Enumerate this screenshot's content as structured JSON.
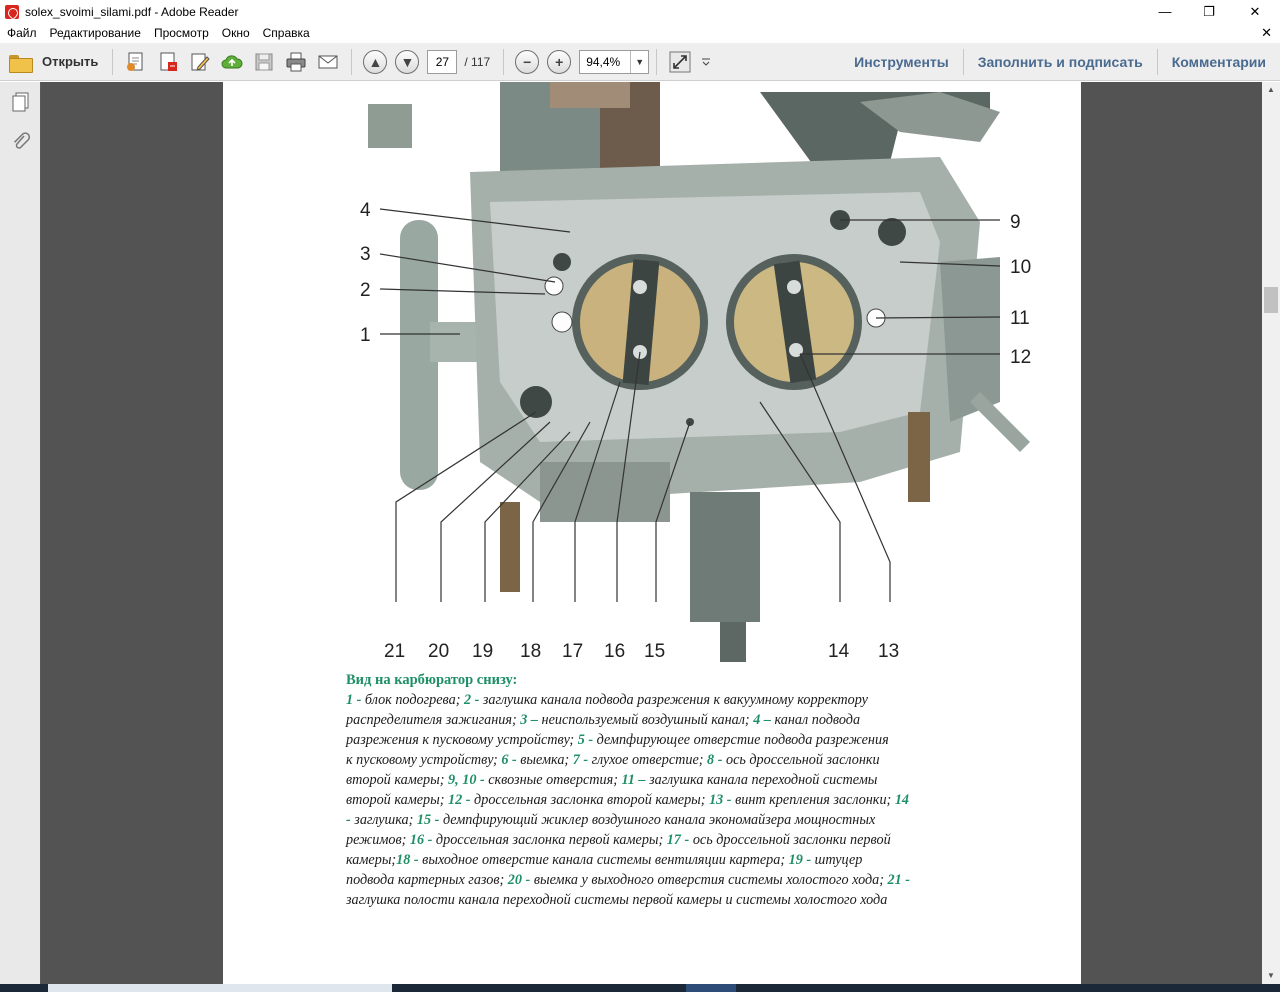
{
  "window": {
    "title": "solex_svoimi_silami.pdf - Adobe Reader",
    "controls": {
      "minimize": "—",
      "restore": "❐",
      "close": "✕"
    }
  },
  "menu": {
    "items": [
      "Файл",
      "Редактирование",
      "Просмотр",
      "Окно",
      "Справка"
    ],
    "close_glyph": "✕"
  },
  "toolbar": {
    "open_label": "Открыть",
    "current_page": "27",
    "total_pages": "/ 117",
    "zoom": "94,4%",
    "right_links": [
      "Инструменты",
      "Заполнить и подписать",
      "Комментарии"
    ]
  },
  "figure": {
    "labels_left": [
      "4",
      "3",
      "2",
      "1"
    ],
    "labels_right": [
      "9",
      "10",
      "11",
      "12"
    ],
    "labels_bottom": [
      "21",
      "20",
      "19",
      "18",
      "17",
      "16",
      "15",
      "14",
      "13"
    ]
  },
  "caption": {
    "heading": "Вид на карбюратор снизу:",
    "lines": [
      [
        [
          "1 -",
          "n"
        ],
        [
          " блок подогрева; ",
          "t"
        ],
        [
          "2 -",
          "n"
        ],
        [
          " заглушка канала подвода разрежения к вакуумному корректору",
          "t"
        ]
      ],
      [
        [
          "распределителя зажигания; ",
          "t"
        ],
        [
          "3 –",
          "n"
        ],
        [
          " неиспользуемый воздушный  канал; ",
          "t"
        ],
        [
          "4 –",
          "n"
        ],
        [
          " канал подвода",
          "t"
        ]
      ],
      [
        [
          "разрежения  к пусковому устройству; ",
          "t"
        ],
        [
          "5 -",
          "n"
        ],
        [
          " демпфирующее отверстие подвода  разрежения",
          "t"
        ]
      ],
      [
        [
          "к   пусковому  устройству; ",
          "t"
        ],
        [
          "6 -",
          "n"
        ],
        [
          " выемка; ",
          "t"
        ],
        [
          "7 -",
          "n"
        ],
        [
          " глухое отверстие; ",
          "t"
        ],
        [
          "8 -",
          "n"
        ],
        [
          " ось дроссельной    заслонки",
          "t"
        ]
      ],
      [
        [
          "второй    камеры; ",
          "t"
        ],
        [
          "9, 10 -",
          "n"
        ],
        [
          " сквозные отверстия; ",
          "t"
        ],
        [
          "11 –",
          "n"
        ],
        [
          " заглушка канала переходной системы",
          "t"
        ]
      ],
      [
        [
          "второй камеры; ",
          "t"
        ],
        [
          "12 -",
          "n"
        ],
        [
          " дроссельная заслонка второй камеры; ",
          "t"
        ],
        [
          "13 -",
          "n"
        ],
        [
          " винт крепления заслонки; ",
          "t"
        ],
        [
          "14",
          "n"
        ]
      ],
      [
        [
          "-",
          "n"
        ],
        [
          " заглушка; ",
          "t"
        ],
        [
          "15 -",
          "n"
        ],
        [
          " демпфирующий жиклер воздушного канала экономайзера мощностных",
          "t"
        ]
      ],
      [
        [
          "режимов; ",
          "t"
        ],
        [
          "16 -",
          "n"
        ],
        [
          " дроссельная  заслонка  первой камеры; ",
          "t"
        ],
        [
          "17 -",
          "n"
        ],
        [
          " ось дроссельной заслонки первой",
          "t"
        ]
      ],
      [
        [
          "камеры;",
          "t"
        ],
        [
          "18 -",
          "n"
        ],
        [
          " выходное отверстие канала системы вентиляции картера; ",
          "t"
        ],
        [
          "19 -",
          "n"
        ],
        [
          " штуцер",
          "t"
        ]
      ],
      [
        [
          "подвода картерных газов; ",
          "t"
        ],
        [
          "20 -",
          "n"
        ],
        [
          " выемка у выходного отверстия системы холостого хода; ",
          "t"
        ],
        [
          "21 -",
          "n"
        ]
      ],
      [
        [
          "заглушка полости канала переходной системы первой камеры и системы холостого хода",
          "t"
        ]
      ]
    ]
  },
  "colors": {
    "accent_number": "#1f8f66",
    "link": "#4a6a90",
    "doc_bg": "#535353"
  }
}
